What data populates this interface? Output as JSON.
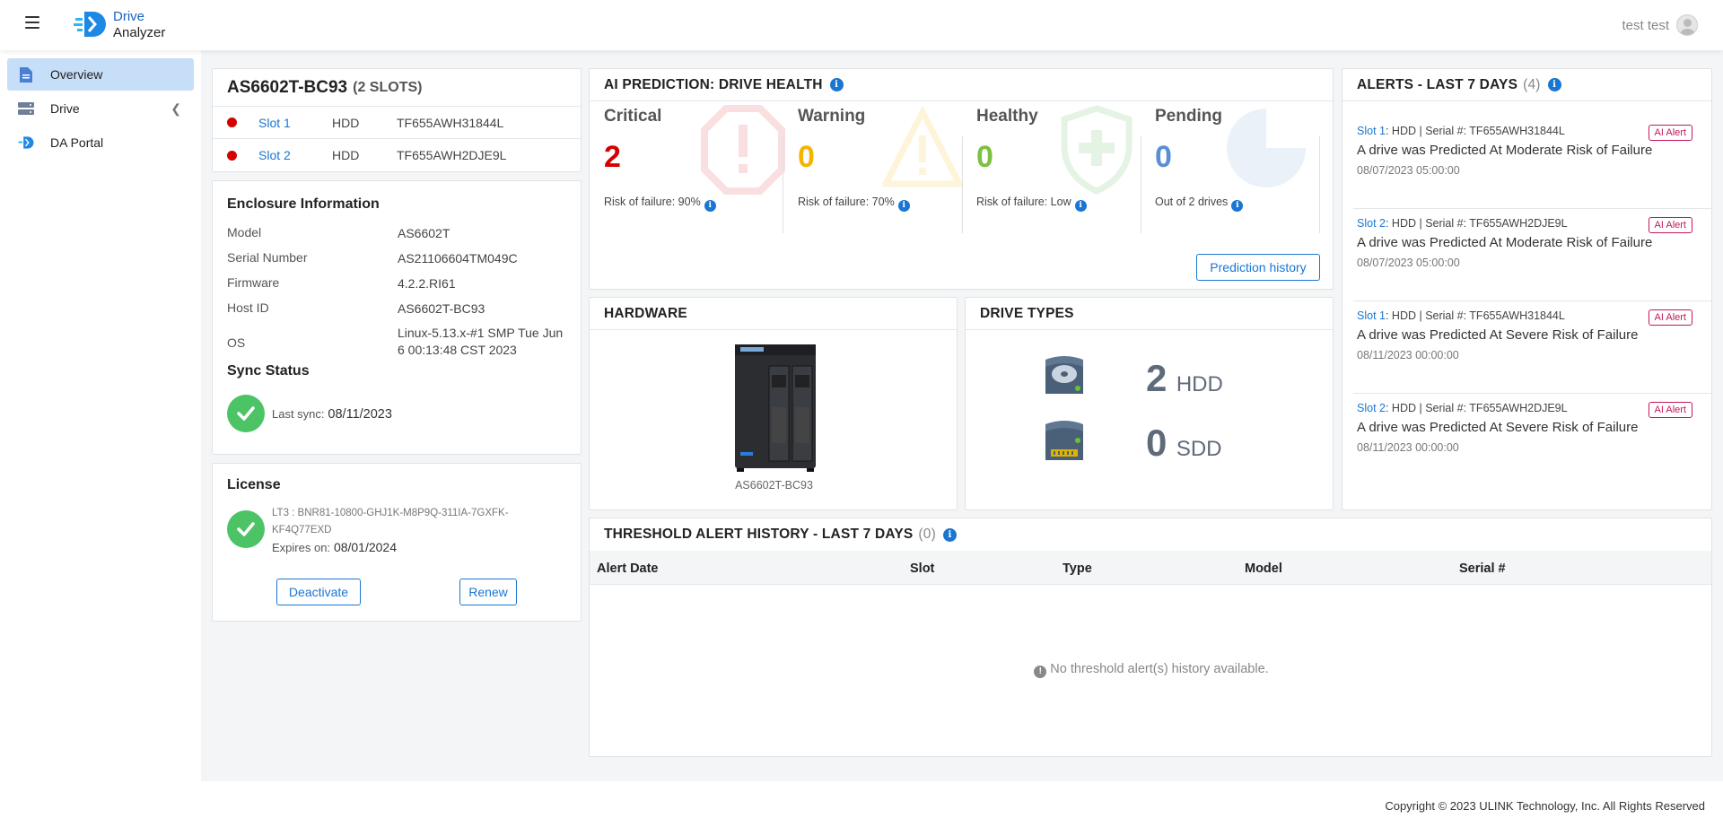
{
  "app": {
    "brand_line1": "Drive",
    "brand_line2": "Analyzer",
    "user_name": "test test"
  },
  "sidebar": {
    "items": [
      {
        "label": "Overview",
        "icon": "document-icon",
        "active": true
      },
      {
        "label": "Drive",
        "icon": "drive-icon",
        "active": false
      },
      {
        "label": "DA Portal",
        "icon": "portal-logo-icon",
        "active": false
      }
    ]
  },
  "device": {
    "name": "AS6602T-BC93",
    "slots_label": "(2 SLOTS)",
    "slots": [
      {
        "name": "Slot 1",
        "type": "HDD",
        "serial": "TF655AWH31844L"
      },
      {
        "name": "Slot 2",
        "type": "HDD",
        "serial": "TF655AWH2DJE9L"
      }
    ]
  },
  "enclosure": {
    "title": "Enclosure Information",
    "rows": [
      {
        "key": "Model",
        "value": "AS6602T"
      },
      {
        "key": "Serial Number",
        "value": "AS21106604TM049C"
      },
      {
        "key": "Firmware",
        "value": "4.2.2.RI61"
      },
      {
        "key": "Host ID",
        "value": "AS6602T-BC93"
      },
      {
        "key": "OS",
        "value": "Linux-5.13.x-#1 SMP Tue Jun 6 00:13:48 CST 2023"
      }
    ],
    "sync_title": "Sync Status",
    "sync_label": "Last sync:",
    "sync_value": "08/11/2023"
  },
  "license": {
    "title": "License",
    "key": "LT3 : BNR81-10800-GHJ1K-M8P9Q-311IA-7GXFK-KF4Q77EXD",
    "expires_label": "Expires on:",
    "expires_value": "08/01/2024",
    "deactivate_label": "Deactivate",
    "renew_label": "Renew"
  },
  "prediction": {
    "title": "AI PREDICTION: DRIVE HEALTH",
    "columns": [
      {
        "label": "Critical",
        "value": "2",
        "sub": "Risk of failure: 90%",
        "color": "#d50000",
        "icon": "stop-warning-icon"
      },
      {
        "label": "Warning",
        "value": "0",
        "sub": "Risk of failure: 70%",
        "color": "#f5b400",
        "icon": "triangle-warning-icon"
      },
      {
        "label": "Healthy",
        "value": "0",
        "sub": "Risk of failure: Low",
        "color": "#7cc142",
        "icon": "shield-plus-icon"
      },
      {
        "label": "Pending",
        "value": "0",
        "sub": "Out of 2 drives",
        "color": "#5a8fd6",
        "icon": "pie-clock-icon"
      }
    ],
    "history_button": "Prediction history"
  },
  "hardware": {
    "title": "HARDWARE",
    "device_label": "AS6602T-BC93"
  },
  "drive_types": {
    "title": "DRIVE TYPES",
    "hdd_count": "2",
    "hdd_label": "HDD",
    "sdd_count": "0",
    "sdd_label": "SDD"
  },
  "alerts": {
    "title": "ALERTS - LAST 7 DAYS",
    "count": "(4)",
    "items": [
      {
        "slot": "Slot 1",
        "detail": ": HDD | Serial #: TF655AWH31844L",
        "badge": "AI Alert",
        "message": "A drive was Predicted At Moderate Risk of Failure",
        "date": "08/07/2023 05:00:00"
      },
      {
        "slot": "Slot 2",
        "detail": ": HDD | Serial #: TF655AWH2DJE9L",
        "badge": "AI Alert",
        "message": "A drive was Predicted At Moderate Risk of Failure",
        "date": "08/07/2023 05:00:00"
      },
      {
        "slot": "Slot 1",
        "detail": ": HDD | Serial #: TF655AWH31844L",
        "badge": "AI Alert",
        "message": "A drive was Predicted At Severe Risk of Failure",
        "date": "08/11/2023 00:00:00"
      },
      {
        "slot": "Slot 2",
        "detail": ": HDD | Serial #: TF655AWH2DJE9L",
        "badge": "AI Alert",
        "message": "A drive was Predicted At Severe Risk of Failure",
        "date": "08/11/2023 00:00:00"
      }
    ]
  },
  "threshold": {
    "title": "THRESHOLD ALERT HISTORY - LAST 7 DAYS",
    "count": "(0)",
    "columns": [
      "Alert Date",
      "Slot",
      "Type",
      "Model",
      "Serial #"
    ],
    "empty_message": "No threshold alert(s) history available."
  },
  "footer": {
    "copyright": "Copyright © 2023 ULINK Technology, Inc. All Rights Reserved"
  }
}
